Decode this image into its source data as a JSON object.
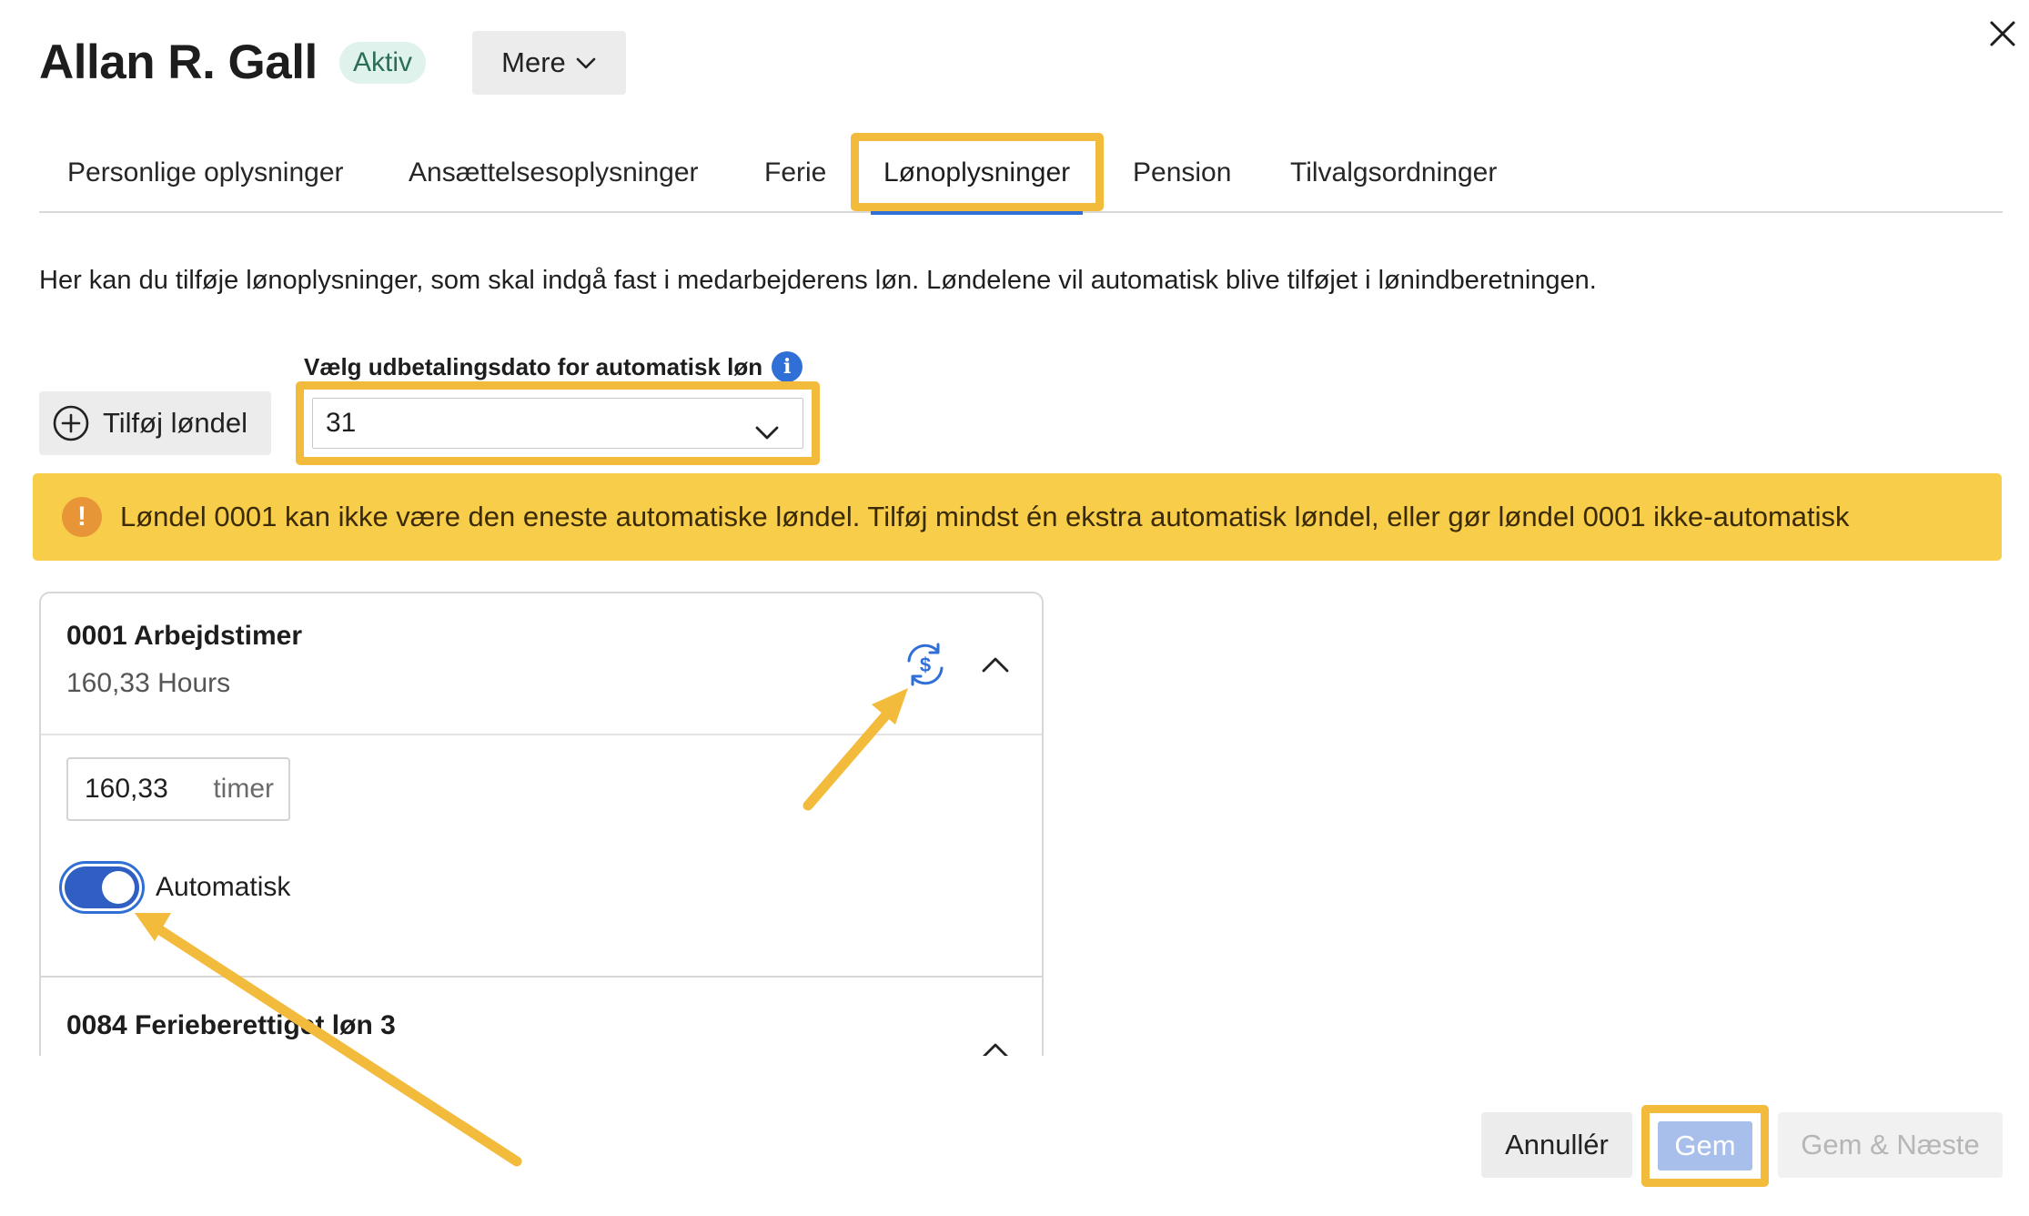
{
  "header": {
    "name": "Allan R. Gall",
    "status": "Aktiv",
    "more_label": "Mere"
  },
  "tabs": [
    {
      "label": "Personlige oplysninger",
      "active": false
    },
    {
      "label": "Ansættelsesoplysninger",
      "active": false
    },
    {
      "label": "Ferie",
      "active": false
    },
    {
      "label": "Lønoplysninger",
      "active": true
    },
    {
      "label": "Pension",
      "active": false
    },
    {
      "label": "Tilvalgsordninger",
      "active": false
    }
  ],
  "description": "Her kan du tilføje lønoplysninger, som skal indgå fast i medarbejderens løn. Løndelene vil automatisk blive tilføjet i lønindberetningen.",
  "add_button_label": "Tilføj løndel",
  "payout": {
    "label": "Vælg udbetalingsdato for automatisk løn",
    "value": "31"
  },
  "warning": {
    "text": "Løndel 0001 kan ikke være den eneste automatiske løndel. Tilføj mindst én ekstra automatisk løndel, eller gør løndel 0001 ikke-automatisk"
  },
  "pay_items": [
    {
      "title": "0001 Arbejdstimer",
      "subtitle": "160,33 Hours",
      "input_value": "160,33",
      "unit": "timer",
      "toggle_label": "Automatisk",
      "automatic": true
    },
    {
      "title": "0084 Ferieberettiget løn 3"
    }
  ],
  "footer": {
    "cancel": "Annullér",
    "save": "Gem",
    "save_next": "Gem & Næste"
  },
  "colors": {
    "accent": "#2f6fd6",
    "highlight": "#f3bb3c",
    "warning_bg": "#f7cd4a"
  }
}
